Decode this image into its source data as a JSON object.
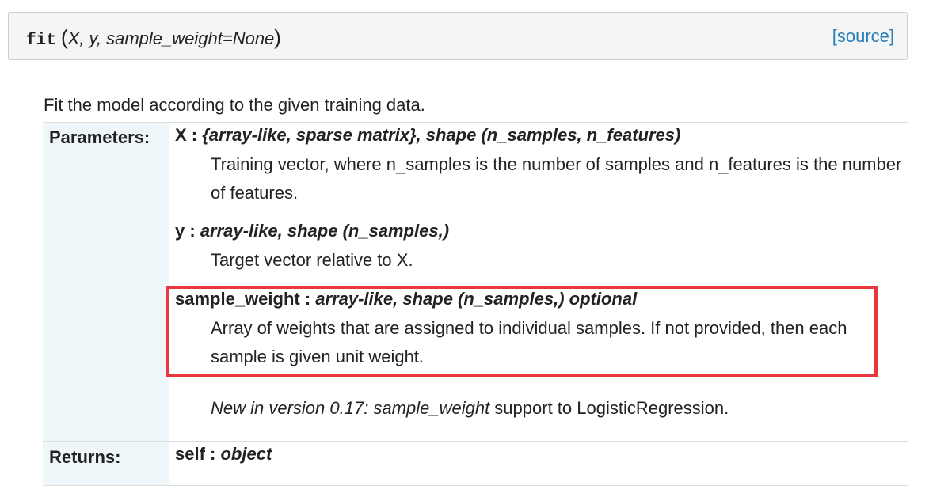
{
  "signature": {
    "name": "fit",
    "open_paren": "(",
    "params": "X, y, sample_weight=None",
    "close_paren": ")",
    "source_link": "[source]"
  },
  "description": "Fit the model according to the given training data.",
  "parameters": {
    "label": "Parameters:",
    "items": [
      {
        "name": "X",
        "separator": " : ",
        "type": "{array-like, sparse matrix}, shape (n_samples, n_features)",
        "description": "Training vector, where n_samples is the number of samples and n_features is the number of features."
      },
      {
        "name": "y",
        "separator": " : ",
        "type": "array-like, shape (n_samples,)",
        "description": "Target vector relative to X."
      },
      {
        "name": "sample_weight",
        "separator": " : ",
        "type": "array-like, shape (n_samples,) optional",
        "description": "Array of weights that are assigned to individual samples. If not provided, then each sample is given unit weight."
      }
    ],
    "version_note": {
      "italic": "New in version 0.17: sample_weight",
      "rest": " support to LogisticRegression."
    }
  },
  "returns": {
    "label": "Returns:",
    "name": "self",
    "separator": " : ",
    "type": "object"
  },
  "colors": {
    "highlight_border": "#e8383d",
    "link": "#2980b9",
    "field_name_bg": "#eef6fa",
    "signature_bg": "#f5f5f5"
  }
}
